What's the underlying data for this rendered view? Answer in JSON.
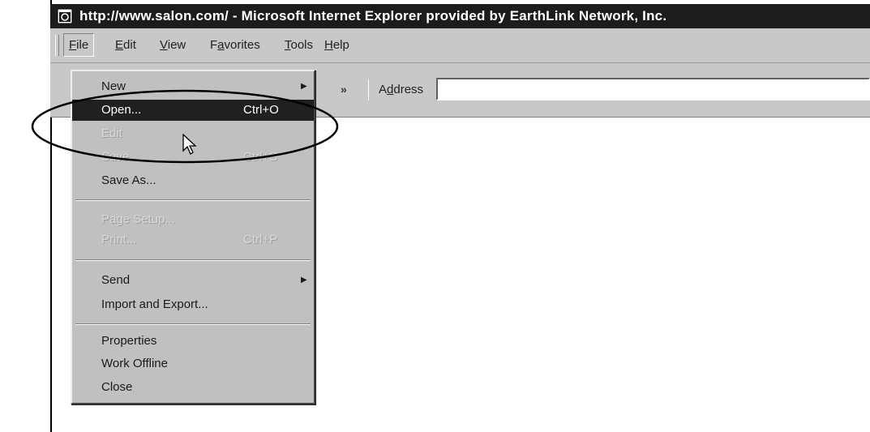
{
  "window": {
    "title": "http://www.salon.com/ - Microsoft Internet Explorer provided by EarthLink Network, Inc."
  },
  "menubar": {
    "items": [
      {
        "label": "File",
        "key": "F",
        "rest": "ile",
        "active": true
      },
      {
        "label": "Edit",
        "key": "E",
        "rest": "dit"
      },
      {
        "label": "View",
        "key": "V",
        "rest": "iew"
      },
      {
        "label": "Favorites",
        "pre": "F",
        "key": "a",
        "rest": "vorites"
      },
      {
        "label": "Tools",
        "key": "T",
        "rest": "ools"
      },
      {
        "label": "Help",
        "key": "H",
        "rest": "elp"
      }
    ]
  },
  "toolbar": {
    "chevron": "»",
    "address_label": "Address",
    "address_key": "d",
    "address_value": ""
  },
  "file_menu": {
    "items": [
      {
        "label": "New",
        "submenu": true,
        "state": "normal"
      },
      {
        "label": "Open...",
        "shortcut": "Ctrl+O",
        "state": "highlighted"
      },
      {
        "label": "Edit",
        "state": "disabled"
      },
      {
        "label": "Save",
        "shortcut": "Ctrl+S",
        "state": "disabled"
      },
      {
        "label": "Save As...",
        "state": "normal"
      },
      {
        "label": "Page Setup...",
        "state": "disabled"
      },
      {
        "label": "Print...",
        "shortcut": "Ctrl+P",
        "state": "disabled"
      },
      {
        "label": "Send",
        "submenu": true,
        "state": "normal"
      },
      {
        "label": "Import and Export...",
        "state": "normal"
      },
      {
        "label": "Properties",
        "state": "normal"
      },
      {
        "label": "Work Offline",
        "state": "normal"
      },
      {
        "label": "Close",
        "state": "normal"
      }
    ]
  },
  "icons": {
    "window": "ie-icon",
    "cursor": "arrow-cursor-icon",
    "submenu": "submenu-arrow-icon"
  },
  "colors": {
    "titlebar": "#1c1c1c",
    "highlight": "#202020",
    "chrome": "#c0c0c0"
  }
}
